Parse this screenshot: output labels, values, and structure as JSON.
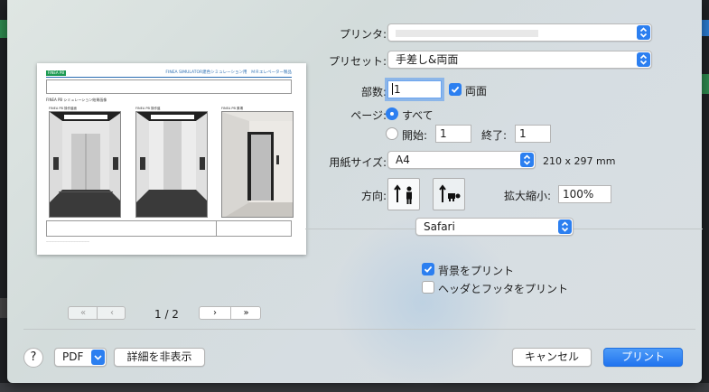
{
  "print": {
    "printer_label": "プリンタ:",
    "printer_value": "",
    "preset_label": "プリセット:",
    "preset_value": "手差し&両面",
    "copies_label": "部数:",
    "copies_value": "1",
    "duplex_label": "両面",
    "pages_label": "ページ:",
    "pages_all_label": "すべて",
    "pages_from_label": "開始:",
    "pages_from_value": "1",
    "pages_to_label": "終了:",
    "pages_to_value": "1",
    "paper_label": "用紙サイズ:",
    "paper_value": "A4",
    "paper_dims": "210 x 297 mm",
    "orientation_label": "方向:",
    "scale_label": "拡大縮小:",
    "scale_value": "100%",
    "app_popup_value": "Safari",
    "bg_print_label": "背景をプリント",
    "header_footer_label": "ヘッダとフッタをプリント",
    "page_indicator": "1 / 2"
  },
  "preview": {
    "tag": "FINEA PB",
    "title": "FINEA SIMULATOR建色シミュレーション用　ＭＲエレベーター製品",
    "subtitle": "FINEA PB シミュレーション結果画像",
    "caption1": "FINEA PB 操作盤面",
    "caption2": "FINEA PB 操作盤",
    "caption3": "FINEA PB 乗場"
  },
  "footer": {
    "help_label": "?",
    "pdf_label": "PDF",
    "details_label": "詳細を非表示",
    "cancel_label": "キャンセル",
    "print_label": "プリント"
  },
  "colors": {
    "accent": "#2c7ff0"
  }
}
